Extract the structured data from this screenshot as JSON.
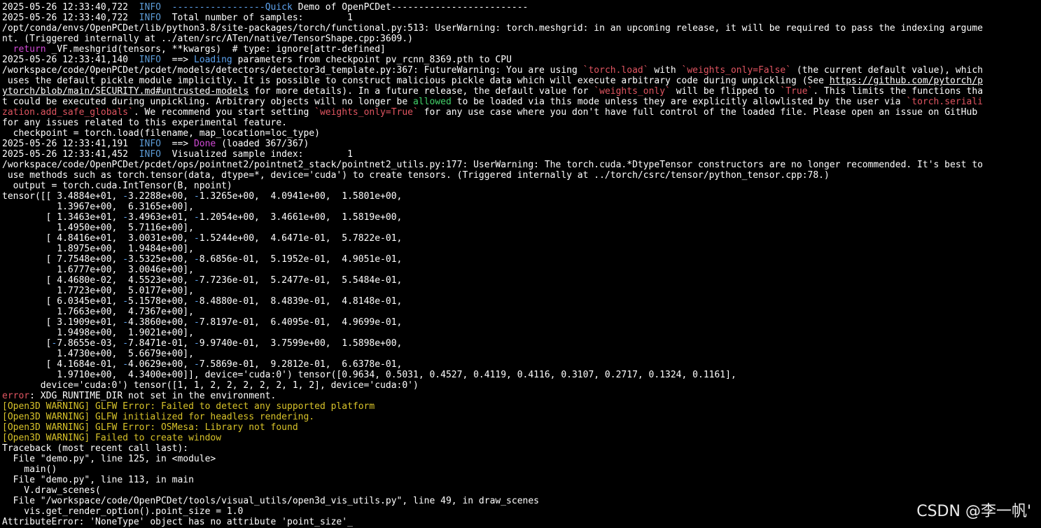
{
  "colors": {
    "background": "#000000",
    "text": "#ffffff",
    "info": "#5c9bd6",
    "blue": "#5ea3ee",
    "red": "#e05561",
    "green": "#43d26a",
    "yellow": "#d8c32a",
    "pink": "#d24ad6"
  },
  "terminal": {
    "lines": [
      [
        {
          "t": "2025-05-26 12:33:40,722  "
        },
        {
          "t": "INFO",
          "c": "info"
        },
        {
          "t": "  "
        },
        {
          "t": "-----------------Quick",
          "c": "blue"
        },
        {
          "t": " Demo of OpenPCDet-------------------------"
        }
      ],
      [
        {
          "t": "2025-05-26 12:33:40,722  "
        },
        {
          "t": "INFO",
          "c": "info"
        },
        {
          "t": "  Total number of samples:        1"
        }
      ],
      [
        {
          "t": "/opt/conda/envs/OpenPCDet/lib/python3.8/site-packages/torch/functional.py:513: UserWarning: torch.meshgrid: in an upcoming release, it will be required to pass the indexing argume"
        }
      ],
      [
        {
          "t": "nt. (Triggered internally at ../aten/src/ATen/native/TensorShape.cpp:3609.)"
        }
      ],
      [
        {
          "t": "  "
        },
        {
          "t": "return",
          "c": "pink"
        },
        {
          "t": " _VF.meshgrid(tensors, **kwargs)  # type: ignore[attr-defined]"
        }
      ],
      [
        {
          "t": "2025-05-26 12:33:41,140  "
        },
        {
          "t": "INFO",
          "c": "info"
        },
        {
          "t": "  ==> "
        },
        {
          "t": "Loading",
          "c": "blue"
        },
        {
          "t": " parameters from checkpoint pv_rcnn_8369.pth to CPU"
        }
      ],
      [
        {
          "t": "/workspace/code/OpenPCDet/pcdet/models/detectors/detector3d_template.py:367: FutureWarning: You are using "
        },
        {
          "t": "`torch.load`",
          "c": "red"
        },
        {
          "t": " with "
        },
        {
          "t": "`weights_only=False`",
          "c": "red"
        },
        {
          "t": " (the current default value), which"
        }
      ],
      [
        {
          "t": " uses the default pickle module implicitly. It is possible to construct malicious pickle data which will execute arbitrary code during unpickling (See "
        },
        {
          "t": "https://github.com/pytorch/p",
          "c": "link"
        }
      ],
      [
        {
          "t": "ytorch/blob/main/SECURITY.md#untrusted-models",
          "c": "link"
        },
        {
          "t": " for more details). In a future release, the default value for "
        },
        {
          "t": "`weights_only`",
          "c": "red"
        },
        {
          "t": " will be flipped to "
        },
        {
          "t": "`True`",
          "c": "red"
        },
        {
          "t": ". This limits the functions tha"
        }
      ],
      [
        {
          "t": "t could be executed during unpickling. Arbitrary objects will no longer be "
        },
        {
          "t": "allowed",
          "c": "green"
        },
        {
          "t": " to be loaded via this mode unless they are explicitly allowlisted by the user via "
        },
        {
          "t": "`torch.seriali",
          "c": "red"
        }
      ],
      [
        {
          "t": "zation.add_safe_globals`",
          "c": "red"
        },
        {
          "t": ". We recommend you start setting "
        },
        {
          "t": "`weights_only=True`",
          "c": "red"
        },
        {
          "t": " for any use case where you don't have full control of the loaded file. Please open an issue on GitHub"
        }
      ],
      [
        {
          "t": "for any issues related to this experimental feature."
        }
      ],
      [
        {
          "t": "  checkpoint = torch.load(filename, map_location=loc_type)"
        }
      ],
      [
        {
          "t": "2025-05-26 12:33:41,191  "
        },
        {
          "t": "INFO",
          "c": "info"
        },
        {
          "t": "  ==> "
        },
        {
          "t": "Done",
          "c": "pink"
        },
        {
          "t": " (loaded 367/367)"
        }
      ],
      [
        {
          "t": "2025-05-26 12:33:41,452  "
        },
        {
          "t": "INFO",
          "c": "info"
        },
        {
          "t": "  Visualized sample index:        1"
        }
      ],
      [
        {
          "t": "/workspace/code/OpenPCDet/pcdet/ops/pointnet2/pointnet2_stack/pointnet2_utils.py:177: UserWarning: The torch.cuda.*DtypeTensor constructors are no longer recommended. It's best to"
        }
      ],
      [
        {
          "t": " use methods such as torch.tensor(data, dtype=*, device='cuda') to create tensors. (Triggered internally at ../torch/csrc/tensor/python_tensor.cpp:78.)"
        }
      ],
      [
        {
          "t": "  output = torch.cuda.IntTensor(B, npoint)"
        }
      ],
      [
        {
          "t": "tensor([[ 3.4884e+01, "
        },
        {
          "t": "-",
          "c": "blue"
        },
        {
          "t": "3.2288e+00, "
        },
        {
          "t": "-",
          "c": "blue"
        },
        {
          "t": "1.3265e+00,  4.0941e+00,  1.5801e+00,"
        }
      ],
      [
        {
          "t": "          1.3967e+00,  6.3165e+00],"
        }
      ],
      [
        {
          "t": "        [ 1.3463e+01, "
        },
        {
          "t": "-",
          "c": "blue"
        },
        {
          "t": "3.4963e+01, "
        },
        {
          "t": "-",
          "c": "blue"
        },
        {
          "t": "1.2054e+00,  3.4661e+00,  1.5819e+00,"
        }
      ],
      [
        {
          "t": "          1.4950e+00,  5.7116e+00],"
        }
      ],
      [
        {
          "t": "        [ 4.8416e+01,  3.0031e+00, "
        },
        {
          "t": "-",
          "c": "blue"
        },
        {
          "t": "1.5244e+00,  4.6471e-01,  5.7822e-01,"
        }
      ],
      [
        {
          "t": "          1.8975e+00,  1.9484e+00],"
        }
      ],
      [
        {
          "t": "        [ 7.7548e+00, "
        },
        {
          "t": "-",
          "c": "blue"
        },
        {
          "t": "3.5325e+00, "
        },
        {
          "t": "-",
          "c": "blue"
        },
        {
          "t": "8.6856e-01,  5.1952e-01,  4.9051e-01,"
        }
      ],
      [
        {
          "t": "          1.6777e+00,  3.0046e+00],"
        }
      ],
      [
        {
          "t": "        [ 4.4680e-02,  4.5523e+00, "
        },
        {
          "t": "-",
          "c": "blue"
        },
        {
          "t": "7.7236e-01,  5.2477e-01,  5.5484e-01,"
        }
      ],
      [
        {
          "t": "          1.7723e+00,  5.0177e+00],"
        }
      ],
      [
        {
          "t": "        [ 6.0345e+01, "
        },
        {
          "t": "-",
          "c": "blue"
        },
        {
          "t": "5.1578e+00, "
        },
        {
          "t": "-",
          "c": "blue"
        },
        {
          "t": "8.4880e-01,  8.4839e-01,  4.8148e-01,"
        }
      ],
      [
        {
          "t": "          1.7663e+00,  4.7367e+00],"
        }
      ],
      [
        {
          "t": "        [ 3.1909e+01, "
        },
        {
          "t": "-",
          "c": "blue"
        },
        {
          "t": "4.3860e+00, "
        },
        {
          "t": "-",
          "c": "blue"
        },
        {
          "t": "7.8197e-01,  6.4095e-01,  4.9699e-01,"
        }
      ],
      [
        {
          "t": "          1.9498e+00,  1.9021e+00],"
        }
      ],
      [
        {
          "t": "        ["
        },
        {
          "t": "-",
          "c": "blue"
        },
        {
          "t": "7.8655e-03, "
        },
        {
          "t": "-",
          "c": "blue"
        },
        {
          "t": "7.8471e-01, "
        },
        {
          "t": "-",
          "c": "blue"
        },
        {
          "t": "9.9740e-01,  3.7599e+00,  1.5898e+00,"
        }
      ],
      [
        {
          "t": "          1.4730e+00,  5.6679e+00],"
        }
      ],
      [
        {
          "t": "        [ 4.1684e-01, "
        },
        {
          "t": "-",
          "c": "blue"
        },
        {
          "t": "4.0629e+00, "
        },
        {
          "t": "-",
          "c": "blue"
        },
        {
          "t": "7.5869e-01,  9.2812e-01,  6.6378e-01,"
        }
      ],
      [
        {
          "t": "          1.9710e+00,  4.3400e+00]], device='cuda:0') tensor([0.9634, 0.5031, 0.4527, 0.4119, 0.4116, 0.3107, 0.2717, 0.1324, 0.1161],"
        }
      ],
      [
        {
          "t": "       device='cuda:0') tensor([1, 1, 2, 2, 2, 2, 2, 1, 2], device='cuda:0')"
        }
      ],
      [
        {
          "t": "error",
          "c": "red"
        },
        {
          "t": ": XDG_RUNTIME_DIR not set in the environment."
        }
      ],
      [
        {
          "t": "[Open3D WARNING] GLFW Error: Failed to detect any supported platform",
          "c": "yellow"
        }
      ],
      [
        {
          "t": "[Open3D WARNING] GLFW initialized for headless rendering.",
          "c": "yellow"
        }
      ],
      [
        {
          "t": "[Open3D WARNING] GLFW Error: OSMesa: Library not found",
          "c": "yellow"
        }
      ],
      [
        {
          "t": "[Open3D WARNING] Failed to create window",
          "c": "yellow"
        }
      ],
      [
        {
          "t": "Traceback (most recent call last):"
        }
      ],
      [
        {
          "t": "  File \"demo.py\", line 125, in <module>"
        }
      ],
      [
        {
          "t": "    main()"
        }
      ],
      [
        {
          "t": "  File \"demo.py\", line 113, in main"
        }
      ],
      [
        {
          "t": "    V.draw_scenes("
        }
      ],
      [
        {
          "t": "  File \"/workspace/code/OpenPCDet/tools/visual_utils/open3d_vis_utils.py\", line 49, in draw_scenes"
        }
      ],
      [
        {
          "t": "    vis.get_render_option().point_size = 1.0"
        }
      ],
      [
        {
          "t": "AttributeError: 'NoneType' object has no attribute 'point_size'_"
        }
      ]
    ]
  },
  "watermark": {
    "text": "CSDN @李一帆'"
  }
}
